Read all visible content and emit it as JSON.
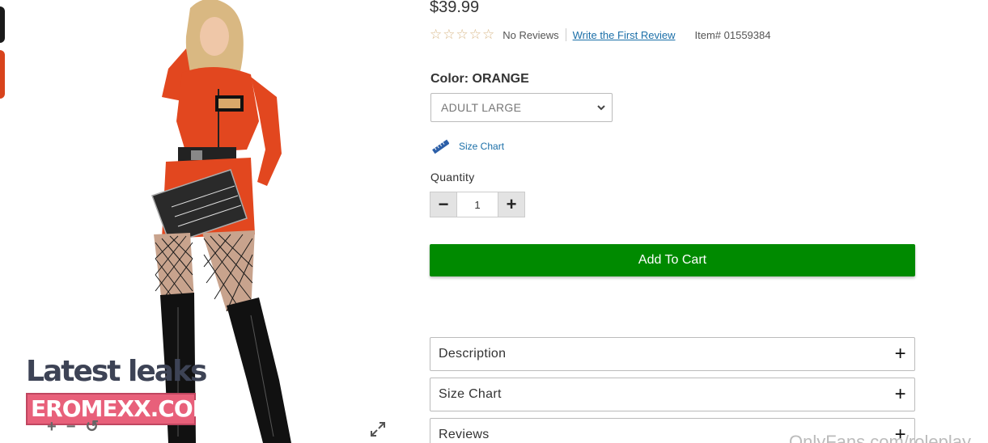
{
  "product": {
    "price": "$39.99",
    "rating": {
      "stars_filled": 0,
      "stars_total": 5,
      "no_reviews": "No Reviews",
      "write_review": "Write the First Review"
    },
    "item_number": "Item# 01559384",
    "color_label": "Color: ORANGE",
    "size_selected": "ADULT LARGE",
    "size_chart_link": "Size Chart",
    "quantity_label": "Quantity",
    "quantity_value": "1",
    "add_to_cart": "Add To Cart"
  },
  "accordions": {
    "description": "Description",
    "size_chart": "Size Chart",
    "reviews": "Reviews"
  },
  "gallery": {
    "zoom_in": "+",
    "zoom_out": "−",
    "reset": "↺"
  },
  "watermark": {
    "title": "Latest leaks",
    "site": "EROMEXX.COM",
    "footer": "OnlyFans.com/roleplay"
  },
  "colors": {
    "accent_green": "#008a00",
    "link_blue": "#1b6fa8",
    "costume_orange": "#e2471f",
    "watermark_pink": "#e8607a"
  }
}
